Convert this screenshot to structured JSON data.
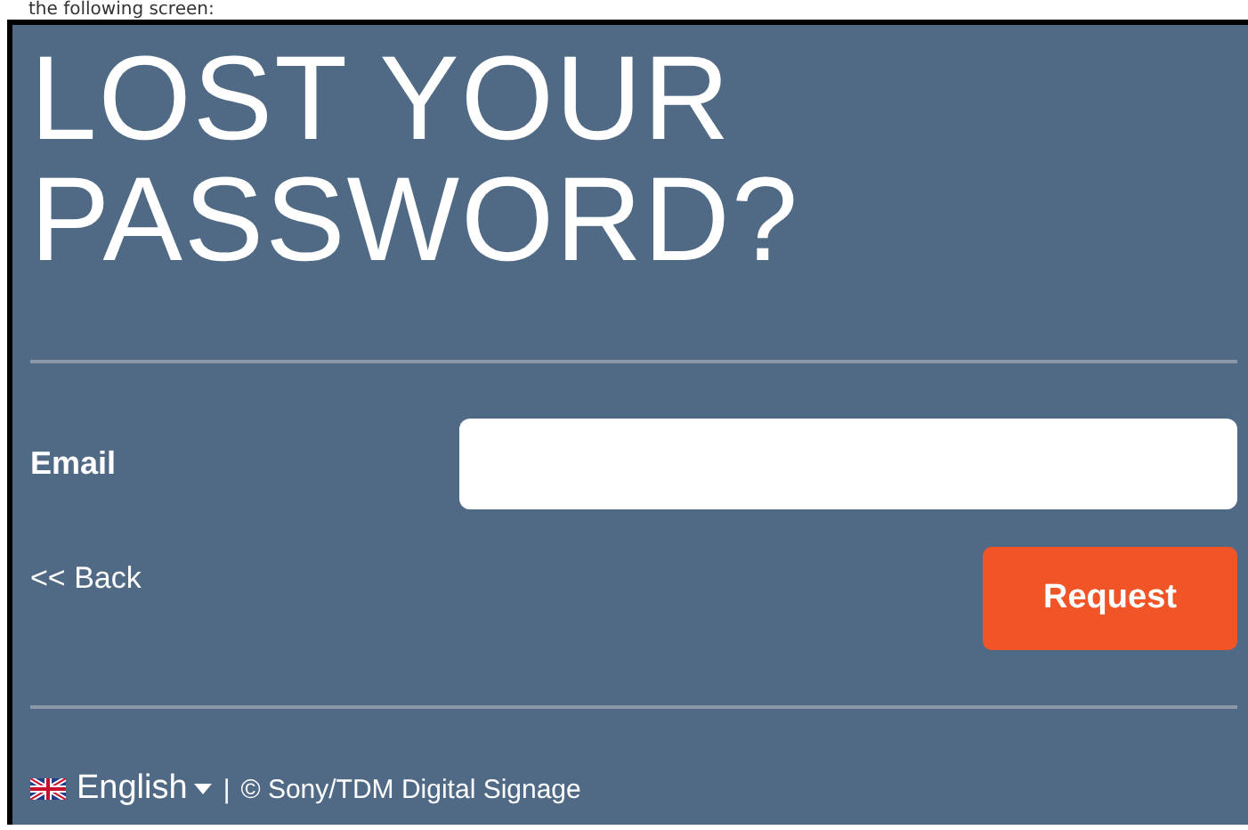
{
  "caption": "the following screen:",
  "title_lines": [
    "LOST YOUR",
    "PASSWORD?"
  ],
  "form": {
    "email_label": "Email",
    "back_link": "<< Back",
    "request_button": "Request"
  },
  "footer": {
    "language": "English",
    "separator": "|",
    "copyright": "© Sony/TDM Digital Signage"
  }
}
